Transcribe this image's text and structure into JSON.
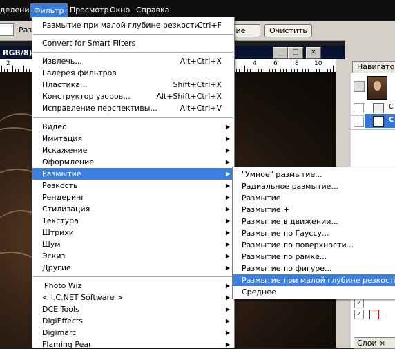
{
  "menubar": {
    "items": [
      "деление",
      "Фильтр",
      "Просмотр",
      "Окно",
      "Справка"
    ]
  },
  "options_bar": {
    "label": "Раз",
    "button_partial": "ие",
    "clear_button": "Очистить"
  },
  "document": {
    "title": "RGB/8)",
    "ruler_numbers": [
      "2",
      "4",
      "6",
      "8",
      "10"
    ],
    "controls": [
      "_",
      "□",
      "×"
    ]
  },
  "navigator": {
    "tab_label": "Навигатор",
    "layers_tab_label": "Слои ×",
    "layer_glyph": "С",
    "row_glyph": "С"
  },
  "filter_menu": {
    "groups": [
      [
        {
          "label": "Размытие при малой глубине резкости",
          "shortcut": "Ctrl+F"
        }
      ],
      [
        {
          "label": "Convert for Smart Filters",
          "shortcut": ""
        }
      ],
      [
        {
          "label": "Извлечь...",
          "shortcut": "Alt+Ctrl+X"
        },
        {
          "label": "Галерея фильтров",
          "shortcut": ""
        },
        {
          "label": "Пластика...",
          "shortcut": "Shift+Ctrl+X"
        },
        {
          "label": "Конструктор узоров...",
          "shortcut": "Alt+Shift+Ctrl+X"
        },
        {
          "label": "Исправление перспективы...",
          "shortcut": "Alt+Ctrl+V"
        }
      ],
      [
        {
          "label": "Видео",
          "shortcut": ""
        },
        {
          "label": "Имитация",
          "shortcut": ""
        },
        {
          "label": "Искажение",
          "shortcut": ""
        },
        {
          "label": "Оформление",
          "shortcut": ""
        },
        {
          "label": "Размытие",
          "shortcut": ""
        },
        {
          "label": "Резкость",
          "shortcut": ""
        },
        {
          "label": "Рендеринг",
          "shortcut": ""
        },
        {
          "label": "Стилизация",
          "shortcut": ""
        },
        {
          "label": "Текстура",
          "shortcut": ""
        },
        {
          "label": "Штрихи",
          "shortcut": ""
        },
        {
          "label": "Шум",
          "shortcut": ""
        },
        {
          "label": "Эскиз",
          "shortcut": ""
        },
        {
          "label": "Другие",
          "shortcut": ""
        }
      ],
      [
        {
          "label": "Photo Wiz",
          "shortcut": ""
        },
        {
          "label": "< I.C.NET Software >",
          "shortcut": ""
        },
        {
          "label": "DCE Tools",
          "shortcut": ""
        },
        {
          "label": "DigiEffects",
          "shortcut": ""
        },
        {
          "label": "Digimarc",
          "shortcut": ""
        },
        {
          "label": "Flaming Pear",
          "shortcut": ""
        }
      ]
    ],
    "highlighted": "Размытие"
  },
  "blur_submenu": {
    "items": [
      "\"Умное\" размытие...",
      "Радиальное размытие...",
      "Размытие",
      "Размытие +",
      "Размытие в движении...",
      "Размытие по Гауссу...",
      "Размытие по поверхности...",
      "Размытие по рамке...",
      "Размытие по фигуре...",
      "Размытие при малой глубине резкости...",
      "Среднее"
    ],
    "highlighted": "Размытие при малой глубине резкости..."
  },
  "colors": {
    "highlight": "#3c7fe0",
    "menubar": "#0f0f0f",
    "panel": "#d4d0c8"
  }
}
